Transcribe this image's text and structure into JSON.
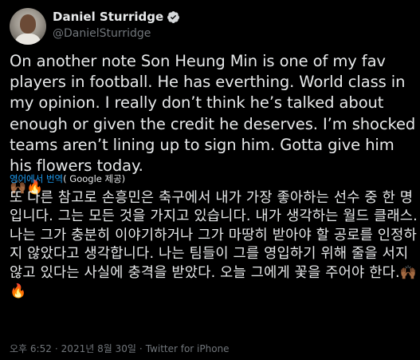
{
  "author": {
    "name": "Daniel Sturridge",
    "handle": "@DanielSturridge",
    "verified": true
  },
  "tweet": {
    "text": "On another note Son Heung Min is one of my fav players in football. He has everthing. World class in my opinion. I really don’t think he’s talked about enough or given the credit he deserves. I’m shocked teams aren’t lining up to sign him. Gotta give him his flowers today.",
    "emojis": "🙌🏾🔥"
  },
  "translation": {
    "link_label": "영어에서 번역",
    "provider_label": "( Google 제공)",
    "text": "또 다른 참고로 손흥민은 축구에서 내가 가장 좋아하는 선수 중 한 명입니다. 그는 모든 것을 가지고 있습니다. 내가 생각하는 월드 클래스. 나는 그가 충분히 이야기하거나 그가 마땅히 받아야 할 공로를 인정하지 않았다고 생각합니다. 나는 팀들이 그를 영입하기 위해 줄을 서지 않고 있다는 사실에 충격을 받았다. 오늘 그에게 꽃을 주어야 한다.",
    "emojis": "🙌🏾🔥"
  },
  "meta": {
    "time": "오후 6:52",
    "date": "2021년 8월 30일",
    "source": "Twitter for iPhone",
    "separator": "·"
  },
  "colors": {
    "background": "#000000",
    "text": "#e7e9ea",
    "muted": "#71767b",
    "link": "#1d9bf0"
  }
}
